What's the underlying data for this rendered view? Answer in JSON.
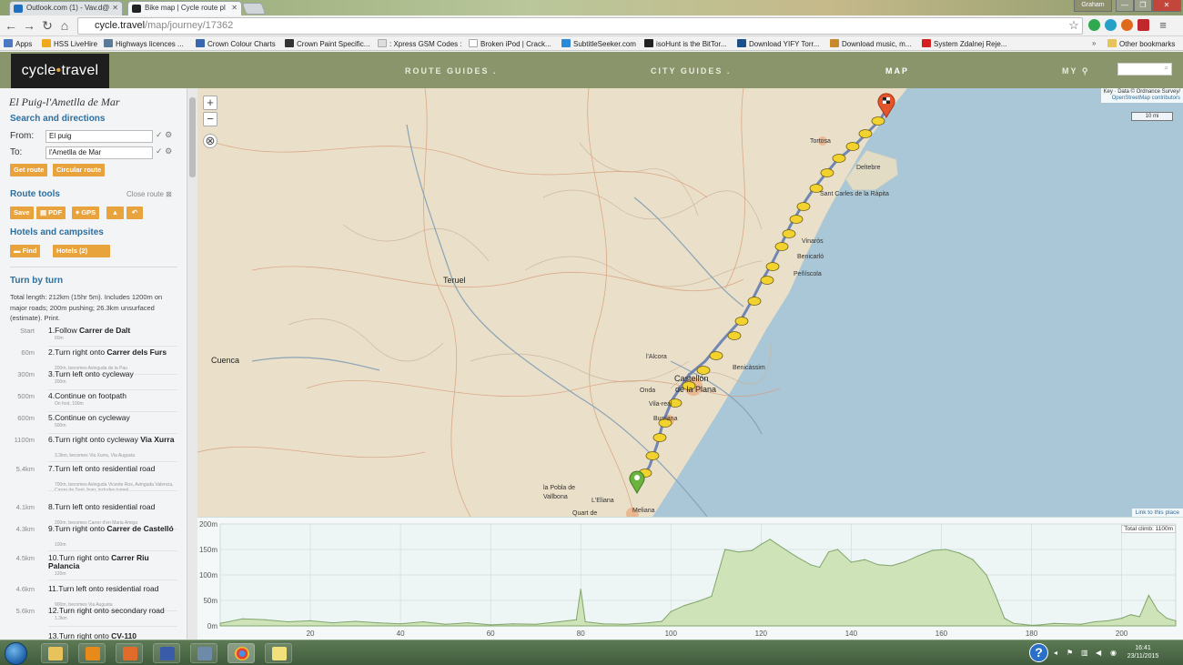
{
  "browser": {
    "tabs": [
      {
        "label": "Outlook.com (1) - Vav.d@",
        "favicon_color": "#1f6fc0"
      },
      {
        "label": "Bike map | Cycle route pl",
        "favicon_color": "#222222"
      }
    ],
    "window_user": "Graham",
    "url_host": "cycle.travel",
    "url_path": "/map/journey/17362",
    "bookmarks": [
      {
        "label": "Apps",
        "icon": "apps-grid-icon",
        "color": "#4a78c2"
      },
      {
        "label": "HSS LiveHire",
        "icon": "hss-icon",
        "color": "#f0a81c"
      },
      {
        "label": "Highways licences ...",
        "icon": "highways-icon",
        "color": "#5a7a9a"
      },
      {
        "label": "Crown Colour Charts",
        "icon": "crown-icon",
        "color": "#3a66b0"
      },
      {
        "label": "Crown Paint Specific...",
        "icon": "crown-paint-icon",
        "color": "#333333"
      },
      {
        "label": ": Xpress GSM Codes :",
        "icon": "page-icon",
        "color": "#dddddd"
      },
      {
        "label": "Broken iPod | Crack...",
        "icon": "page-icon",
        "color": "#ffffff"
      },
      {
        "label": "SubtitleSeeker.com",
        "icon": "subtitle-icon",
        "color": "#2a8ad8"
      },
      {
        "label": "isoHunt is the BitTor...",
        "icon": "isohunt-icon",
        "color": "#222222"
      },
      {
        "label": "Download YIFY Torr...",
        "icon": "yify-icon",
        "color": "#1a4f8a"
      },
      {
        "label": "Download music, m...",
        "icon": "music-icon",
        "color": "#c78a2a"
      },
      {
        "label": "System Zdalnej Reje...",
        "icon": "flag-pl-icon",
        "color": "#d42020"
      }
    ],
    "other_bookmarks": "Other bookmarks"
  },
  "site": {
    "logo": "cycle.travel",
    "logo_left": "cycle",
    "logo_dot": "•",
    "logo_right": "travel",
    "nav": [
      "ROUTE GUIDES",
      "CITY GUIDES",
      "MAP",
      "MY"
    ],
    "nav_dot": ".",
    "accent": "#e8a33c",
    "header_color": "#8a956b"
  },
  "sidebar": {
    "title": "El Puig-l'Ametlla de Mar",
    "search_heading": "Search and directions",
    "from_label": "From:",
    "from_value": "El puig",
    "to_label": "To:",
    "to_value": "l'Ametlla de Mar",
    "get_route": "Get route",
    "circular_route": "Circular route",
    "route_tools_heading": "Route tools",
    "close_route": "Close route",
    "tools": {
      "save": "Save",
      "pdf": "PDF",
      "gps": "GPS"
    },
    "hotels_heading": "Hotels and campsites",
    "find": "Find",
    "hotels_count": "Hotels (2)",
    "turn_heading": "Turn by turn",
    "summary": "Total length: 212km (15hr 5m). Includes 1200m on major roads; 200m pushing; 26.3km unsurfaced (estimate). Print.",
    "steps": [
      {
        "dist": "Start",
        "num": "1.",
        "pre": "Follow ",
        "bold": "Carrer de Dalt",
        "post": "",
        "sub": "60m"
      },
      {
        "dist": "60m",
        "num": "2.",
        "pre": "Turn right onto ",
        "bold": "Carrer dels Furs",
        "post": "",
        "sub": "200m, becomes Avinguda de la Pau"
      },
      {
        "dist": "300m",
        "num": "3.",
        "pre": "Turn left onto cycleway",
        "bold": "",
        "post": "",
        "sub": "200m"
      },
      {
        "dist": "500m",
        "num": "4.",
        "pre": "Continue on footpath",
        "bold": "",
        "post": "",
        "sub": "On foot, 100m"
      },
      {
        "dist": "600m",
        "num": "5.",
        "pre": "Continue on cycleway",
        "bold": "",
        "post": "",
        "sub": "500m"
      },
      {
        "dist": "1100m",
        "num": "6.",
        "pre": "Turn right onto cycleway ",
        "bold": "Via Xurra",
        "post": "",
        "sub": "3.3km, becomes Via Xurra, Via Augusta"
      },
      {
        "dist": "5.4km",
        "num": "7.",
        "pre": "Turn left onto residential road",
        "bold": "",
        "post": "",
        "sub": "700m, becomes Avinguda Vicente Ros, Avinguda Valencia, Carrer de Sant Joan; includes tunnel"
      },
      {
        "dist": "4.1km",
        "num": "8.",
        "pre": "Turn left onto residential road",
        "bold": "",
        "post": "",
        "sub": "200m, becomes Carrer d'en Maria Amiga"
      },
      {
        "dist": "4.3km",
        "num": "9.",
        "pre": "Turn right onto ",
        "bold": "Carrer de Castelló",
        "post": "",
        "sub": "100m"
      },
      {
        "dist": "4.5km",
        "num": "10.",
        "pre": "Turn right onto ",
        "bold": "Carrer Riu Palancia",
        "post": "",
        "sub": "120m"
      },
      {
        "dist": "4.6km",
        "num": "11.",
        "pre": "Turn left onto residential road",
        "bold": "",
        "post": "",
        "sub": "900m, becomes Via Augusta"
      },
      {
        "dist": "5.6km",
        "num": "12.",
        "pre": "Turn right onto secondary road",
        "bold": "",
        "post": "",
        "sub": "1.3km"
      },
      {
        "dist": "",
        "num": "13.",
        "pre": "Turn right onto ",
        "bold": "CV-110",
        "post": "",
        "sub": ""
      }
    ]
  },
  "map": {
    "zoom_in": "+",
    "zoom_out": "−",
    "attribution_1": "Key · Data © Ordnance Survey/",
    "attribution_2": "OpenStreetMap contributors",
    "scale": "10 mi",
    "link": "Link to this place",
    "places": [
      {
        "name": "Teruel",
        "cls": "big"
      },
      {
        "name": "Cuenca",
        "cls": "big"
      },
      {
        "name": "Tortosa",
        "cls": ""
      },
      {
        "name": "Deltebre",
        "cls": ""
      },
      {
        "name": "Sant Carles de la Ràpita",
        "cls": ""
      },
      {
        "name": "Vinaròs",
        "cls": ""
      },
      {
        "name": "Benicarló",
        "cls": ""
      },
      {
        "name": "Peñíscola",
        "cls": ""
      },
      {
        "name": "l'Alcora",
        "cls": ""
      },
      {
        "name": "Benicàssim",
        "cls": ""
      },
      {
        "name": "Castellón",
        "cls": "big"
      },
      {
        "name": "de la Plana",
        "cls": "big"
      },
      {
        "name": "Onda",
        "cls": ""
      },
      {
        "name": "Vila-real",
        "cls": ""
      },
      {
        "name": "Burriana",
        "cls": ""
      },
      {
        "name": "la Pobla de",
        "cls": ""
      },
      {
        "name": "Vallbona",
        "cls": ""
      },
      {
        "name": "L'Eliana",
        "cls": ""
      },
      {
        "name": "Quart de",
        "cls": ""
      },
      {
        "name": "Meliana",
        "cls": ""
      }
    ]
  },
  "elevation": {
    "total_climb": "Total climb: 1100m",
    "y_ticks": [
      "200m",
      "150m",
      "100m",
      "50m",
      "0m"
    ],
    "x_ticks": [
      "20",
      "40",
      "60",
      "80",
      "100",
      "120",
      "140",
      "160",
      "180",
      "200"
    ]
  },
  "chart_data": {
    "type": "area",
    "title": "",
    "xlabel": "",
    "ylabel": "",
    "xlim": [
      0,
      212
    ],
    "ylim": [
      0,
      200
    ],
    "x": [
      0,
      5,
      10,
      15,
      20,
      25,
      30,
      35,
      40,
      45,
      50,
      55,
      60,
      65,
      70,
      75,
      79,
      80,
      81,
      85,
      90,
      95,
      98,
      100,
      103,
      106,
      109,
      112,
      115,
      118,
      120,
      122,
      125,
      128,
      131,
      133,
      135,
      137,
      140,
      143,
      146,
      149,
      152,
      155,
      158,
      161,
      164,
      167,
      170,
      172,
      174,
      176,
      178,
      180,
      182,
      185,
      188,
      191,
      194,
      197,
      200,
      202,
      204,
      206,
      208,
      210,
      212
    ],
    "series": [
      {
        "name": "",
        "values": [
          5,
          14,
          12,
          8,
          10,
          6,
          9,
          6,
          4,
          8,
          3,
          6,
          2,
          4,
          3,
          8,
          12,
          72,
          8,
          4,
          3,
          6,
          9,
          28,
          40,
          48,
          58,
          150,
          145,
          148,
          160,
          170,
          152,
          135,
          120,
          115,
          145,
          150,
          125,
          130,
          120,
          118,
          126,
          138,
          148,
          150,
          143,
          130,
          100,
          60,
          15,
          5,
          3,
          1,
          2,
          5,
          4,
          3,
          8,
          10,
          15,
          22,
          18,
          60,
          30,
          15,
          10
        ]
      }
    ],
    "grid": true
  },
  "taskbar": {
    "clock_time": "16:41",
    "clock_date": "23/11/2015",
    "help": "?"
  }
}
